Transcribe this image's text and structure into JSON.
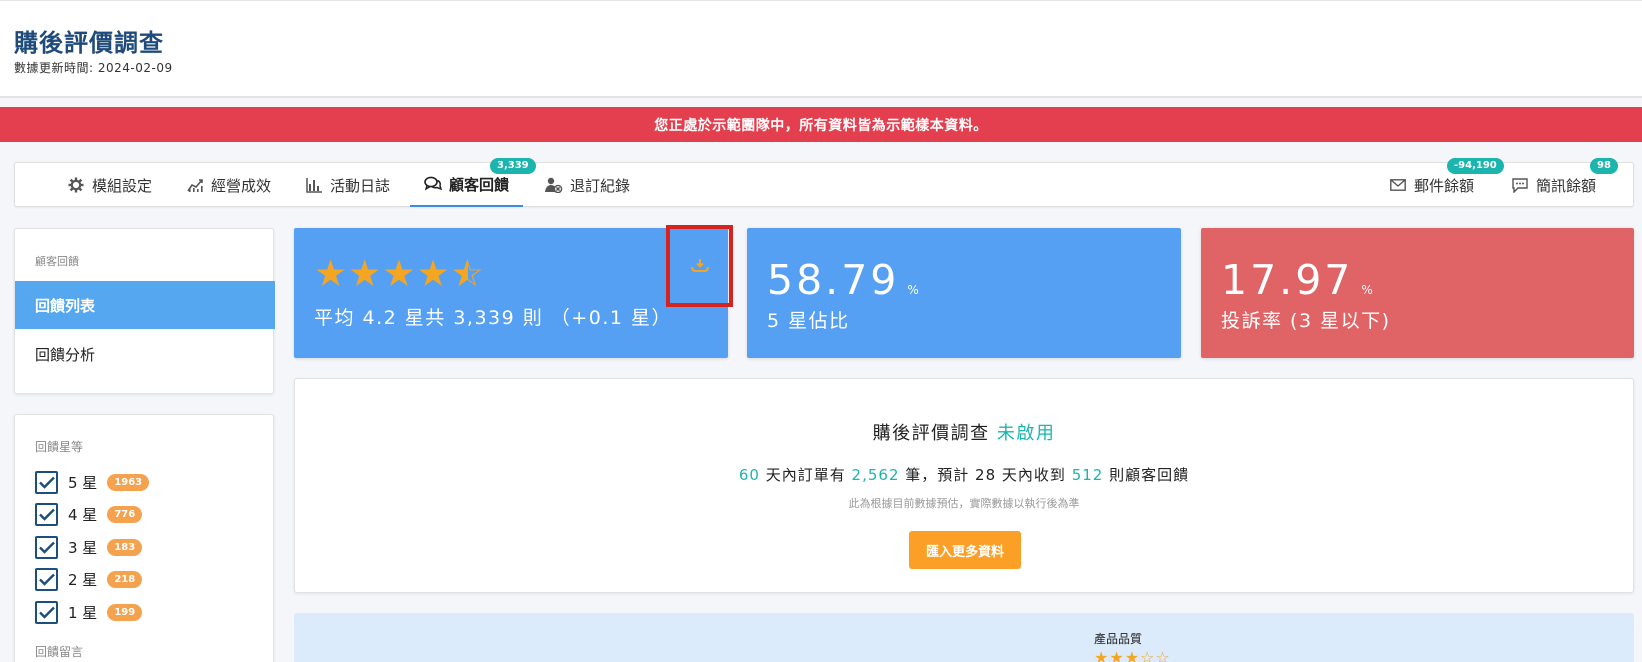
{
  "header": {
    "title": "購後評價調查",
    "updated": "數據更新時間: 2024-02-09"
  },
  "banner": {
    "text": "您正處於示範團隊中，所有資料皆為示範樣本資料。"
  },
  "nav": {
    "tabs": [
      {
        "label": "模組設定",
        "icon": "gear-icon"
      },
      {
        "label": "經營成效",
        "icon": "chart-line-icon"
      },
      {
        "label": "活動日誌",
        "icon": "bar-chart-icon"
      },
      {
        "label": "顧客回饋",
        "icon": "comments-icon",
        "badge": "3,339",
        "active": true
      },
      {
        "label": "退訂紀錄",
        "icon": "user-remove-icon"
      }
    ],
    "right": [
      {
        "label": "郵件餘額",
        "icon": "mail-icon",
        "badge": "-94,190"
      },
      {
        "label": "簡訊餘額",
        "icon": "sms-icon",
        "badge": "98"
      }
    ]
  },
  "sidebar": {
    "heading": "顧客回饋",
    "items": [
      {
        "label": "回饋列表",
        "active": true
      },
      {
        "label": "回饋分析",
        "active": false
      }
    ]
  },
  "filters": {
    "heading": "回饋星等",
    "rows": [
      {
        "label": "5 星",
        "count": "1963",
        "checked": true
      },
      {
        "label": "4 星",
        "count": "776",
        "checked": true
      },
      {
        "label": "3 星",
        "count": "183",
        "checked": true
      },
      {
        "label": "2 星",
        "count": "218",
        "checked": true
      },
      {
        "label": "1 星",
        "count": "199",
        "checked": true
      }
    ],
    "heading2": "回饋留言"
  },
  "stats": {
    "rating": {
      "stars": 4.2,
      "text": "平均 4.2 星共 3,339 則 （+0.1 星）"
    },
    "five_star": {
      "value": "58.79",
      "unit": "%",
      "label": "5 星佔比"
    },
    "complaint": {
      "value": "17.97",
      "unit": "%",
      "label": "投訴率 (3 星以下)"
    }
  },
  "survey": {
    "title": "購後評價調查",
    "status": "未啟用",
    "line": {
      "days": "60",
      "t1": "天內訂單有",
      "orders": "2,562",
      "t2": "筆，預計 28 天內收到",
      "reviews": "512",
      "t3": "則顧客回饋"
    },
    "note": "此為根據目前數據預估，實際數據以執行後為準",
    "import_label": "匯入更多資料"
  },
  "bottom": {
    "quality_label": "產品品質",
    "quality_stars": 3
  },
  "colors": {
    "accent": "#55a7ef",
    "teal": "#1cb5ad",
    "red": "#e33f4f",
    "orange": "#fb9f27",
    "star": "#f4a521"
  }
}
